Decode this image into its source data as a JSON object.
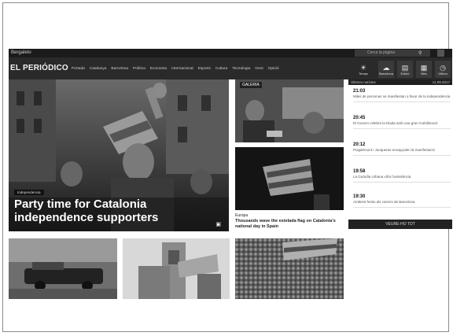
{
  "topbar": {
    "language": "Bergaleto",
    "search_placeholder": "Cerca la pàgina"
  },
  "navbar": {
    "logo": "EL PERIÓDICO",
    "links": [
      "Portada",
      "Catalunya",
      "Barcelona",
      "Política",
      "Economia",
      "Internacional",
      "Esports",
      "Cultura",
      "Tecnologia",
      "Gent",
      "Opinió"
    ],
    "tools": [
      {
        "icon": "weather-icon",
        "label": "Temps"
      },
      {
        "icon": "cloud-icon",
        "label": "Barcelona"
      },
      {
        "icon": "document-icon",
        "label": "Edició"
      },
      {
        "icon": "grid-icon",
        "label": "Més"
      },
      {
        "icon": "clock-icon",
        "label": "Última"
      }
    ]
  },
  "hero": {
    "tag": "Independencia",
    "title": "Party time for Catalonia independence supporters"
  },
  "mid": {
    "label": "GALERIA",
    "category": "Europa",
    "headline": "Thousands wave the estelada flag on Catalonia's national day in Spain"
  },
  "sidebar": {
    "title": "Últimes notícies",
    "date": "11.09.2017",
    "items": [
      {
        "time": "21:03",
        "text": "Miles de personas se manifiestan a favor de la independencia"
      },
      {
        "time": "20:45",
        "text": "El Govern celebra la Diada amb una gran mobilització"
      },
      {
        "time": "20:12",
        "text": "Puigdemont i Junqueras encapçalen la manifestació"
      },
      {
        "time": "19:58",
        "text": "La Guàrdia Urbana xifra l'assistència"
      },
      {
        "time": "19:30",
        "text": "Ambient festiu als carrers de Barcelona"
      }
    ],
    "more": "VEURE-HO TOT"
  },
  "colors": {
    "nav_bg": "#2a2a2a",
    "topbar_bg": "#1b1b1b",
    "sidebar_head_bg": "#1f1f1f"
  }
}
